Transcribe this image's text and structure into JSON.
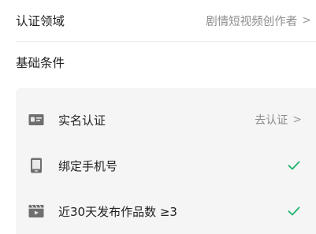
{
  "certification": {
    "label": "认证领域",
    "value": "剧情短视频创作者",
    "chevron": ">"
  },
  "section": {
    "title": "基础条件"
  },
  "conditions": [
    {
      "icon": "id-card-icon",
      "label": "实名认证",
      "action": "去认证",
      "chevron": ">",
      "status": "pending"
    },
    {
      "icon": "phone-icon",
      "label": "绑定手机号",
      "status": "done"
    },
    {
      "icon": "video-icon",
      "label": "近30天发布作品数 ≥3",
      "status": "done"
    }
  ],
  "colors": {
    "check": "#22b573",
    "panel": "#f5f5f5",
    "muted": "#8e8e8e"
  }
}
